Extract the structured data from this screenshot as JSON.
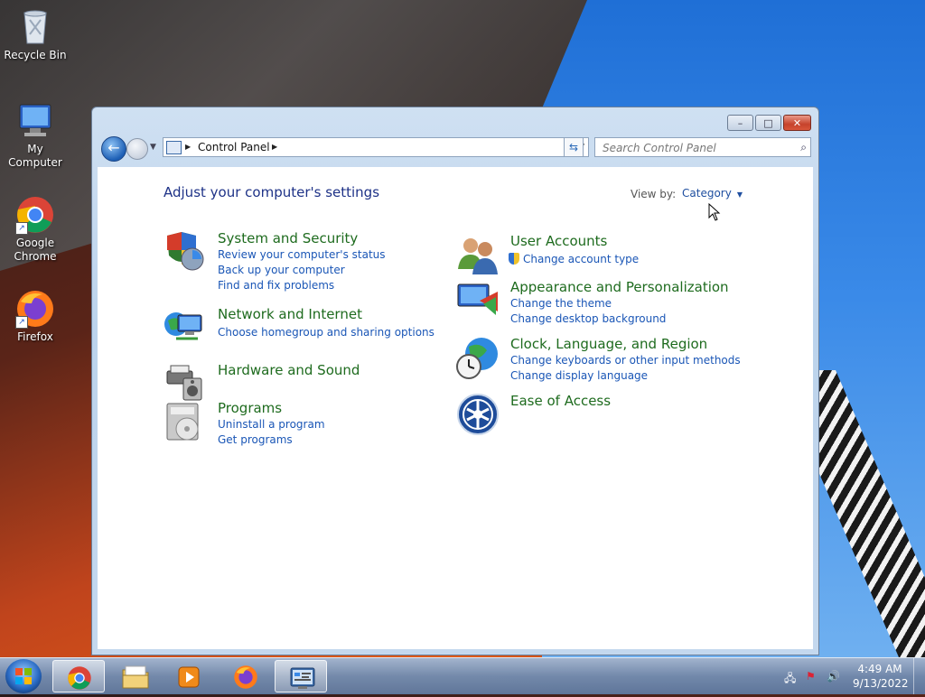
{
  "desktop": {
    "icons": [
      {
        "label": "Recycle Bin",
        "icon": "recycle-bin-icon"
      },
      {
        "label": "My Computer",
        "icon": "computer-icon"
      },
      {
        "label": "Google Chrome",
        "icon": "chrome-icon"
      },
      {
        "label": "Firefox",
        "icon": "firefox-icon"
      }
    ]
  },
  "window": {
    "caption_buttons": {
      "minimize": "–",
      "maximize": "□",
      "close": "✕"
    },
    "address": {
      "crumb": "Control Panel",
      "back_icon": "back-arrow-icon",
      "forward_icon": "forward-arrow-icon"
    },
    "search": {
      "placeholder": "Search Control Panel",
      "icon": "search-icon"
    },
    "page_title": "Adjust your computer's settings",
    "view_by": {
      "label": "View by:",
      "value": "Category"
    },
    "categories": [
      {
        "title": "System and Security",
        "icon": "system-security-icon",
        "links": [
          "Review your computer's status",
          "Back up your computer",
          "Find and fix problems"
        ]
      },
      {
        "title": "Network and Internet",
        "icon": "network-internet-icon",
        "links": [
          "Choose homegroup and sharing options"
        ]
      },
      {
        "title": "Hardware and Sound",
        "icon": "hardware-sound-icon",
        "links": []
      },
      {
        "title": "Programs",
        "icon": "programs-icon",
        "links": [
          "Uninstall a program",
          "Get programs"
        ]
      },
      {
        "title": "User Accounts",
        "icon": "user-accounts-icon",
        "links": [
          "Change account type"
        ]
      },
      {
        "title": "Appearance and Personalization",
        "icon": "appearance-icon",
        "links": [
          "Change the theme",
          "Change desktop background"
        ]
      },
      {
        "title": "Clock, Language, and Region",
        "icon": "clock-language-icon",
        "links": [
          "Change keyboards or other input methods",
          "Change display language"
        ]
      },
      {
        "title": "Ease of Access",
        "icon": "ease-of-access-icon",
        "links": []
      }
    ]
  },
  "taskbar": {
    "items": [
      {
        "name": "chrome",
        "icon": "chrome-icon",
        "active": true
      },
      {
        "name": "file-explorer",
        "icon": "folder-icon",
        "active": false
      },
      {
        "name": "media-player",
        "icon": "media-player-icon",
        "active": false
      },
      {
        "name": "firefox",
        "icon": "firefox-icon",
        "active": false
      },
      {
        "name": "control-panel",
        "icon": "control-panel-icon",
        "active": true
      }
    ],
    "clock": {
      "time": "4:49 AM",
      "date": "9/13/2022"
    }
  }
}
